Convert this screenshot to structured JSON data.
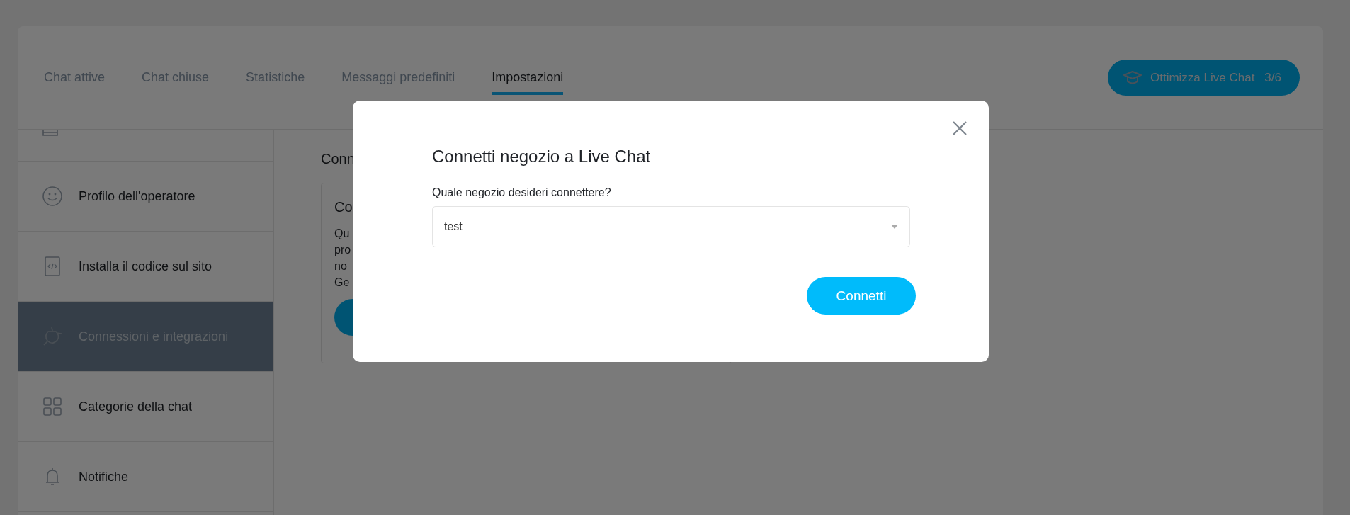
{
  "tabs": [
    {
      "label": "Chat attive",
      "selected": false
    },
    {
      "label": "Chat chiuse",
      "selected": false
    },
    {
      "label": "Statistiche",
      "selected": false
    },
    {
      "label": "Messaggi predefiniti",
      "selected": false
    },
    {
      "label": "Impostazioni",
      "selected": true
    }
  ],
  "optimize_button": {
    "label": "Ottimizza Live Chat",
    "progress": "3/6"
  },
  "sidebar": {
    "items": [
      {
        "kind": "face",
        "label": "Profilo dell'operatore",
        "selected": false
      },
      {
        "kind": "code",
        "label": "Installa il codice sul sito",
        "selected": false
      },
      {
        "kind": "plug",
        "label": "Connessioni e integrazioni",
        "selected": true
      },
      {
        "kind": "grid",
        "label": "Categorie della chat",
        "selected": false
      },
      {
        "kind": "bell",
        "label": "Notifiche",
        "selected": false
      }
    ]
  },
  "content": {
    "heading": "Conn",
    "card": {
      "title": "Co",
      "lines": [
        "Qu",
        "pro",
        "no",
        "Ge"
      ]
    }
  },
  "modal": {
    "title": "Connetti negozio a Live Chat",
    "field_label": "Quale negozio desideri connettere?",
    "select": {
      "value": "test"
    },
    "button": "Connetti"
  }
}
